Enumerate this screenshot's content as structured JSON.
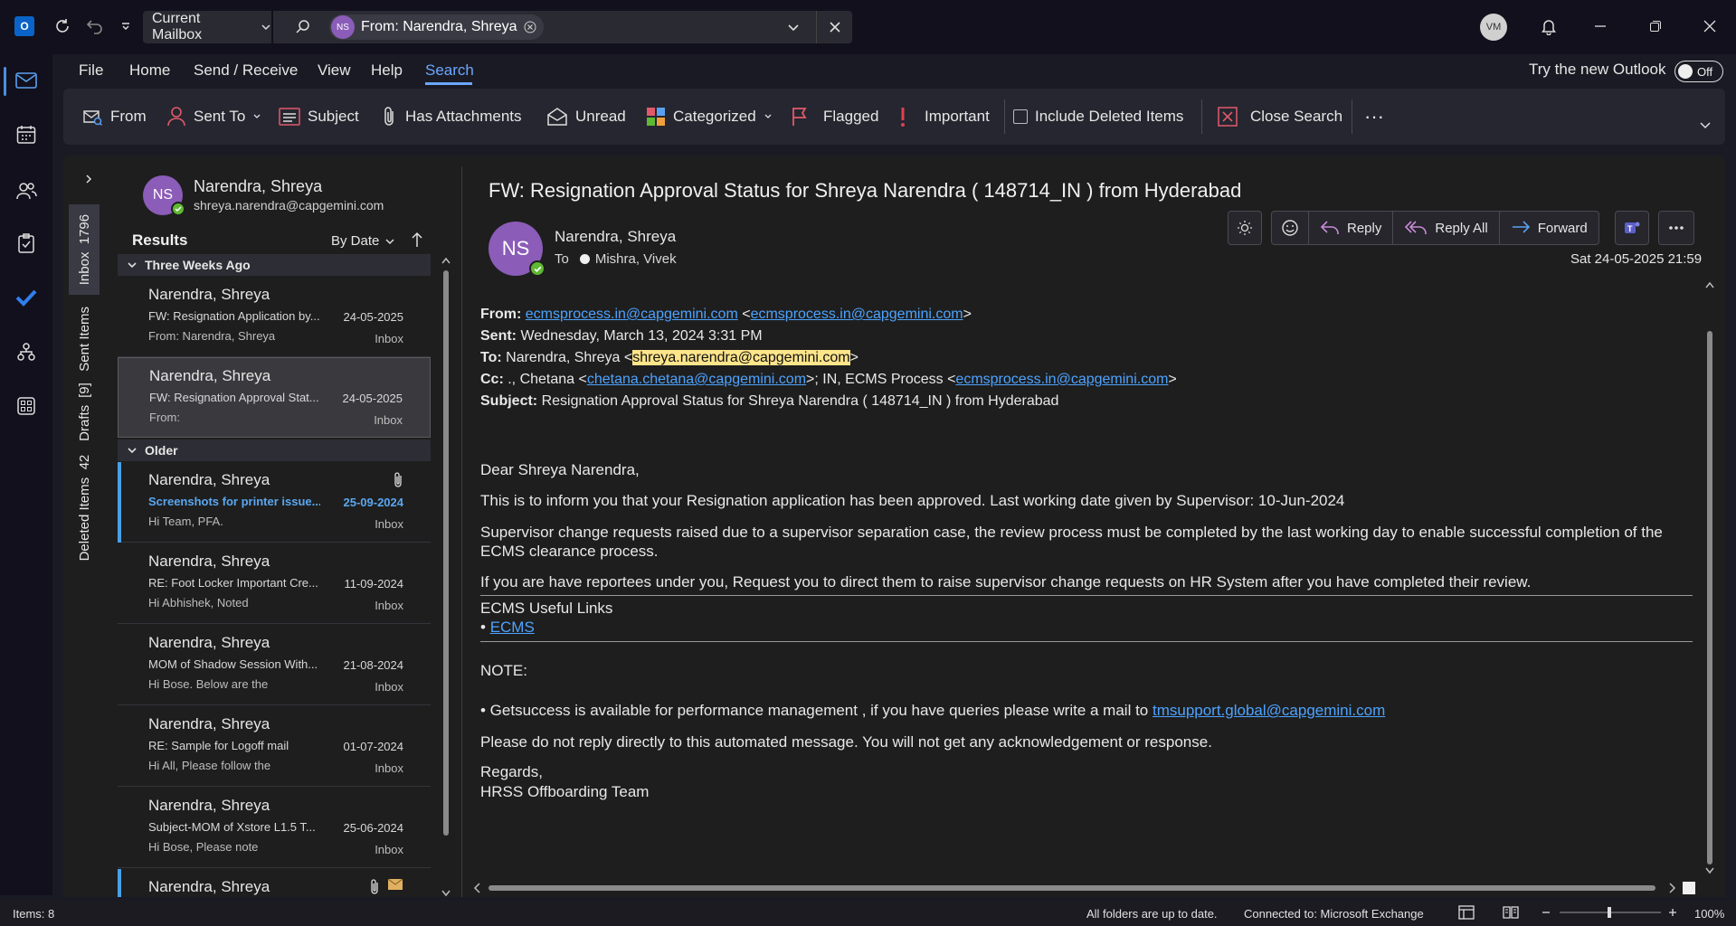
{
  "titlebar": {
    "scope_label": "Current Mailbox",
    "search_chip_initials": "NS",
    "search_chip_text": "From: Narendra, Shreya",
    "user_initials": "VM"
  },
  "menu": {
    "items": [
      "File",
      "Home",
      "Send / Receive",
      "View",
      "Help",
      "Search"
    ],
    "try_new_label": "Try the new Outlook",
    "toggle_label": "Off"
  },
  "ribbon": {
    "from": "From",
    "sent_to": "Sent To",
    "subject": "Subject",
    "has_attachments": "Has Attachments",
    "unread": "Unread",
    "categorized": "Categorized",
    "flagged": "Flagged",
    "important": "Important",
    "include_deleted": "Include Deleted Items",
    "close_search": "Close Search",
    "more": "···"
  },
  "folders": [
    {
      "name": "Inbox",
      "count": "1796"
    },
    {
      "name": "Sent Items",
      "count": ""
    },
    {
      "name": "Drafts",
      "count": "[9]"
    },
    {
      "name": "Deleted Items",
      "count": "42"
    }
  ],
  "contact_card": {
    "initials": "NS",
    "name": "Narendra, Shreya",
    "email": "shreya.narendra@capgemini.com"
  },
  "list": {
    "results_label": "Results",
    "sort_label": "By Date",
    "groups": [
      "Three Weeks Ago",
      "Older"
    ],
    "messages": [
      {
        "from": "Narendra, Shreya",
        "subject": "FW: Resignation Application by...",
        "date": "24-05-2025",
        "preview": "From: Narendra, Shreya",
        "folder": "Inbox"
      },
      {
        "from": "Narendra, Shreya",
        "subject": "FW: Resignation Approval Stat...",
        "date": "24-05-2025",
        "preview": "From:",
        "folder": "Inbox"
      },
      {
        "from": "Narendra, Shreya",
        "subject": "Screenshots for printer issue...",
        "date": "25-09-2024",
        "preview": "Hi Team,  PFA.",
        "folder": "Inbox"
      },
      {
        "from": "Narendra, Shreya",
        "subject": "RE: Foot Locker Important Cre...",
        "date": "11-09-2024",
        "preview": "Hi Abhishek,  Noted",
        "folder": "Inbox"
      },
      {
        "from": "Narendra, Shreya",
        "subject": "MOM of Shadow Session With...",
        "date": "21-08-2024",
        "preview": "Hi Bose.  Below are the",
        "folder": "Inbox"
      },
      {
        "from": "Narendra, Shreya",
        "subject": "RE: Sample for Logoff mail",
        "date": "01-07-2024",
        "preview": "Hi All,  Please follow the",
        "folder": "Inbox"
      },
      {
        "from": "Narendra, Shreya",
        "subject": "Subject-MOM of Xstore L1.5 T...",
        "date": "25-06-2024",
        "preview": "Hi Bose,  Please note",
        "folder": "Inbox"
      },
      {
        "from": "Narendra, Shreya",
        "subject": "",
        "date": "",
        "preview": "",
        "folder": ""
      }
    ]
  },
  "reading": {
    "subject": "FW: Resignation Approval Status for Shreya Narendra ( 148714_IN ) from Hyderabad",
    "sender_initials": "NS",
    "sender": "Narendra, Shreya",
    "to_label": "To",
    "to_name": "Mishra, Vivek",
    "actions": {
      "reply": "Reply",
      "reply_all": "Reply All",
      "forward": "Forward"
    },
    "date": "Sat 24-05-2025 21:59",
    "hdr": {
      "from_label": "From:",
      "from_link1": "ecmsprocess.in@capgemini.com",
      "from_link2": "ecmsprocess.in@capgemini.com",
      "sent_label": "Sent:",
      "sent_value": "Wednesday, March 13, 2024 3:31 PM",
      "to_label": "To:",
      "to_name": "Narendra, Shreya <",
      "to_email": "shreya.narendra@capgemini.com",
      "cc_label": "Cc:",
      "cc_name": "., Chetana <",
      "cc_link1": "chetana.chetana@capgemini.com",
      "cc_mid": ">; IN, ECMS Process <",
      "cc_link2": "ecmsprocess.in@capgemini.com",
      "subject_label": "Subject:",
      "subject_value": "Resignation Approval Status for Shreya Narendra ( 148714_IN ) from Hyderabad"
    },
    "body": {
      "greeting": "Dear Shreya Narendra,",
      "p1": "This is to inform you that your Resignation application has been approved. Last working date given by Supervisor: 10-Jun-2024",
      "p2": "Supervisor change requests raised due to a supervisor separation case, the review process must be completed by the last working day to enable successful completion of the ECMS clearance process.",
      "p3": "If you are have reportees under you, Request you to direct them to raise supervisor change requests on HR System after you have completed their review.",
      "links_title": "ECMS Useful Links",
      "link_ecms": "ECMS",
      "note": "NOTE:",
      "note_text": "• Getsuccess is available for performance management , if you have queries please write a mail to ",
      "note_link": "tmsupport.global@capgemini.com",
      "no_reply": "Please do not reply directly to this automated message. You will not get any acknowledgement or response.",
      "regards": "Regards,",
      "team": "HRSS Offboarding Team"
    }
  },
  "status": {
    "items": "Items: 8",
    "folders": "All folders are up to date.",
    "connection": "Connected to: Microsoft Exchange",
    "zoom": "100%"
  },
  "colors": {
    "accent": "#6aa7ff",
    "unread": "#5aa7f0",
    "avatar": "#8b5cb8",
    "highlight": "#ffe58a"
  }
}
